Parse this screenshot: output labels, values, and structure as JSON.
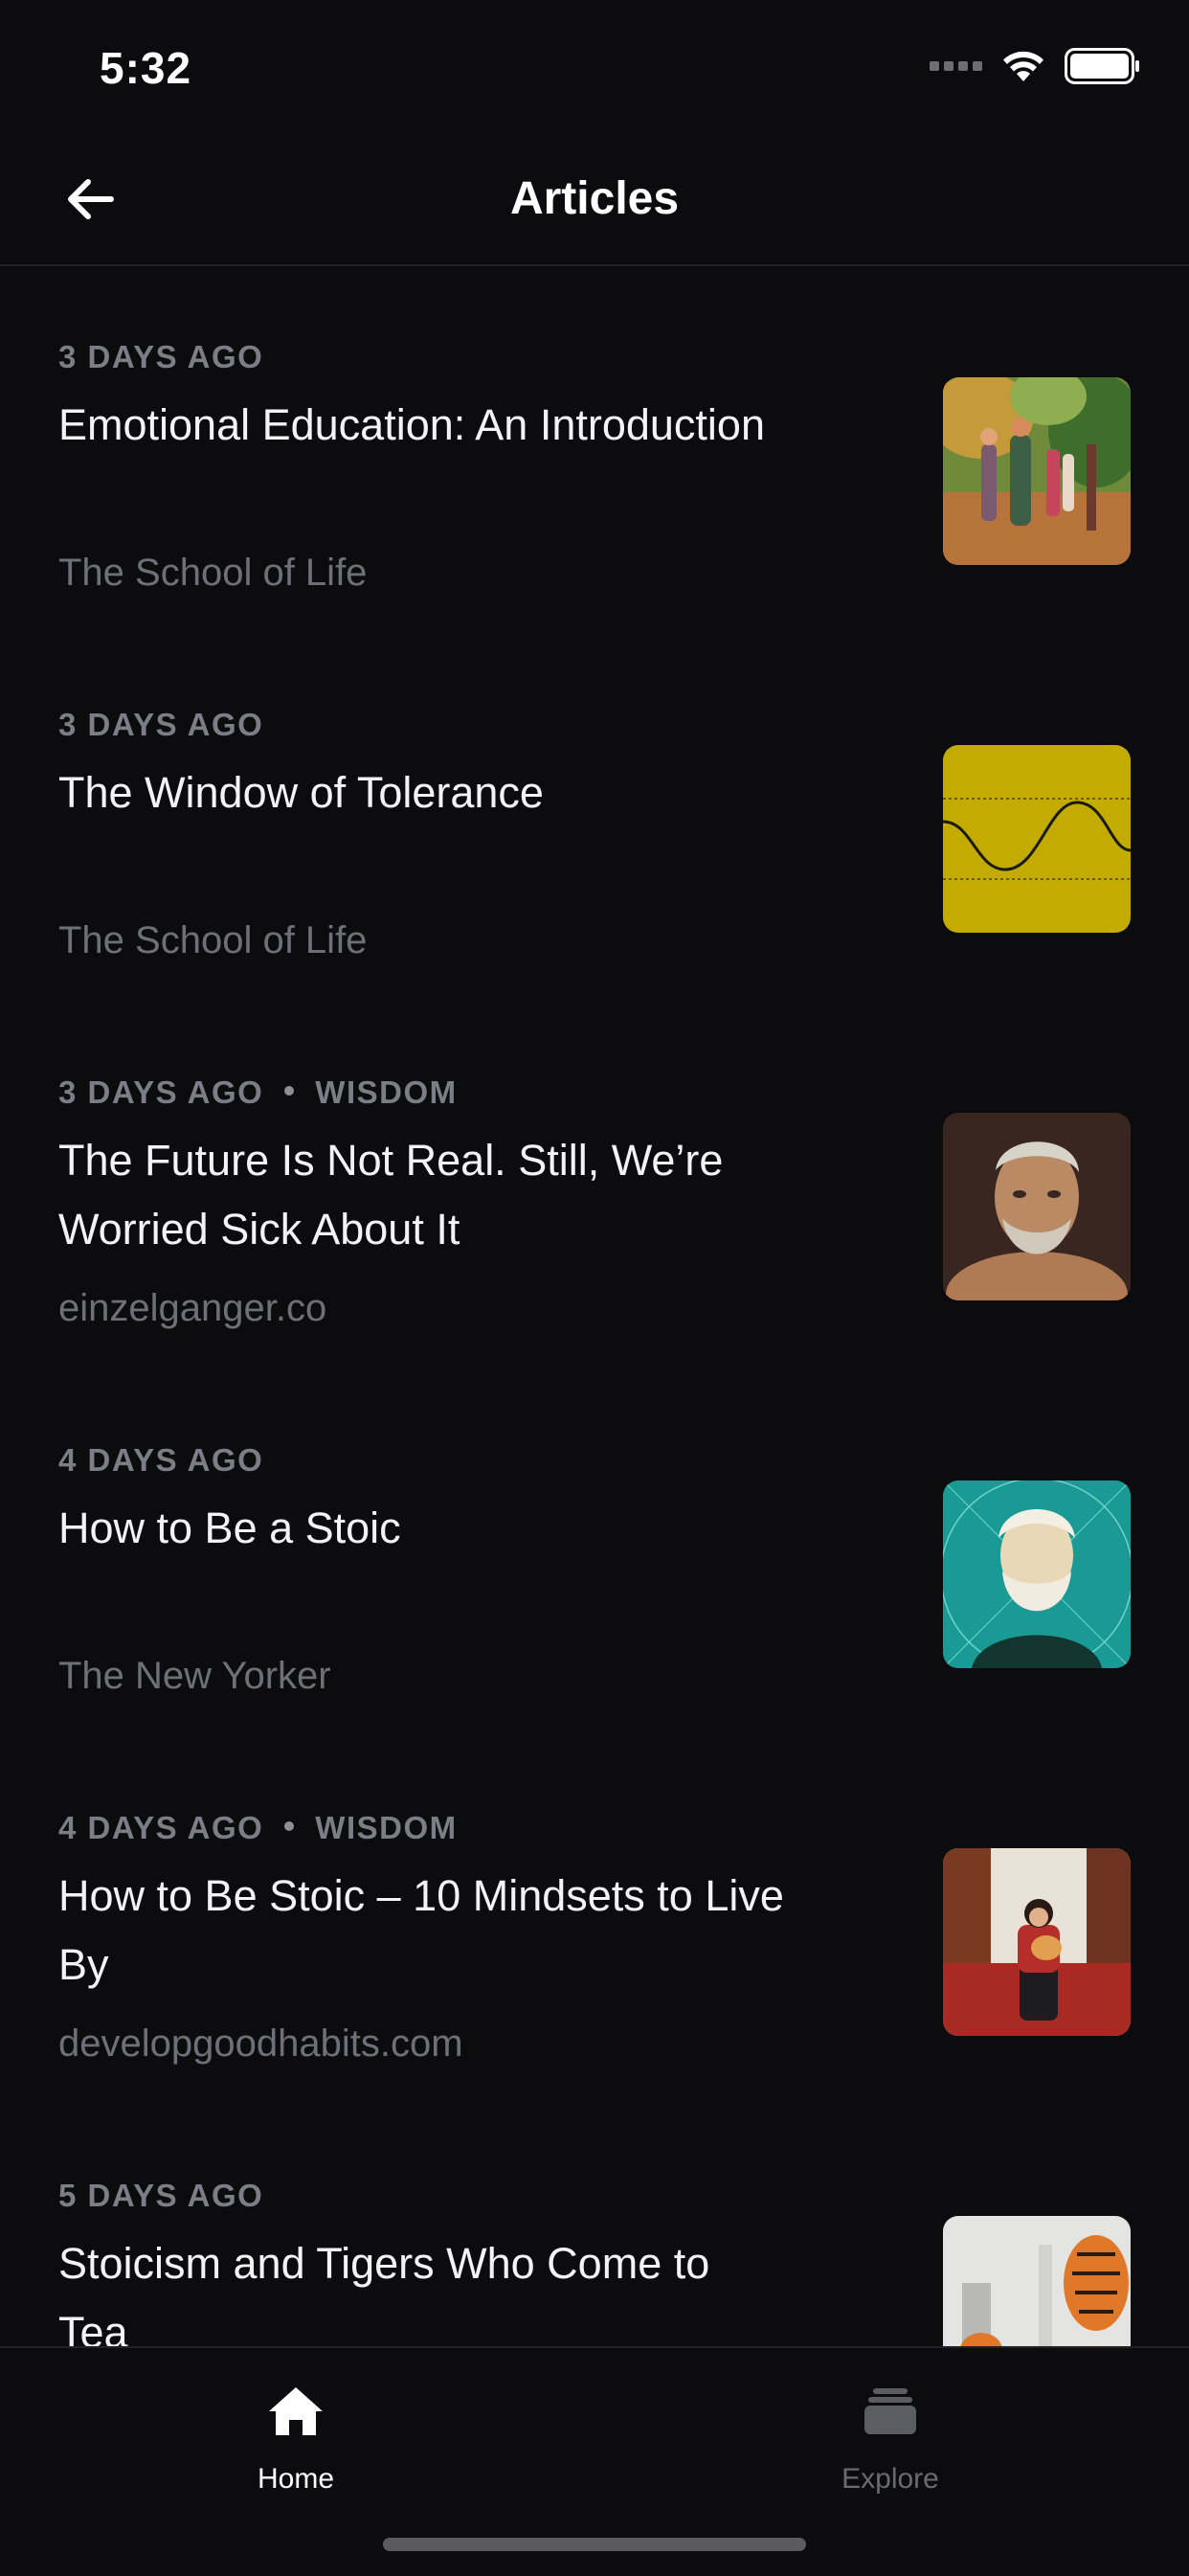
{
  "status_bar": {
    "time": "5:32"
  },
  "nav": {
    "title": "Articles",
    "back_icon": "arrow-left-icon"
  },
  "articles": [
    {
      "date": "3 DAYS AGO",
      "tag": "",
      "title": "Emotional Education: An Introduction",
      "source": "The School of Life",
      "thumb": "painting-figures-trees"
    },
    {
      "date": "3 DAYS AGO",
      "tag": "",
      "title": "The Window of Tolerance",
      "source": "The School of Life",
      "thumb": "yellow-wave-diagram"
    },
    {
      "date": "3 DAYS AGO",
      "tag": "WISDOM",
      "title": "The Future Is Not Real. Still, We’re Worried Sick About It",
      "source": "einzelganger.co",
      "thumb": "seneca-bust"
    },
    {
      "date": "4 DAYS AGO",
      "tag": "",
      "title": "How to Be a Stoic",
      "source": "The New Yorker",
      "thumb": "teal-bearded-philosopher"
    },
    {
      "date": "4 DAYS AGO",
      "tag": "WISDOM",
      "title": "How to Be Stoic – 10 Mindsets to Live By",
      "source": "developgoodhabits.com",
      "thumb": "woman-with-cat"
    },
    {
      "date": "5 DAYS AGO",
      "tag": "",
      "title": "Stoicism and Tigers Who Come to Tea",
      "source": "",
      "thumb": "tiger-illustration"
    }
  ],
  "tabbar": {
    "home": {
      "label": "Home",
      "icon": "home-icon"
    },
    "explore": {
      "label": "Explore",
      "icon": "stack-icon"
    }
  },
  "colors": {
    "background": "#0c0c0e",
    "secondary_text": "#7d7d85",
    "source_text": "#6f6f78"
  }
}
